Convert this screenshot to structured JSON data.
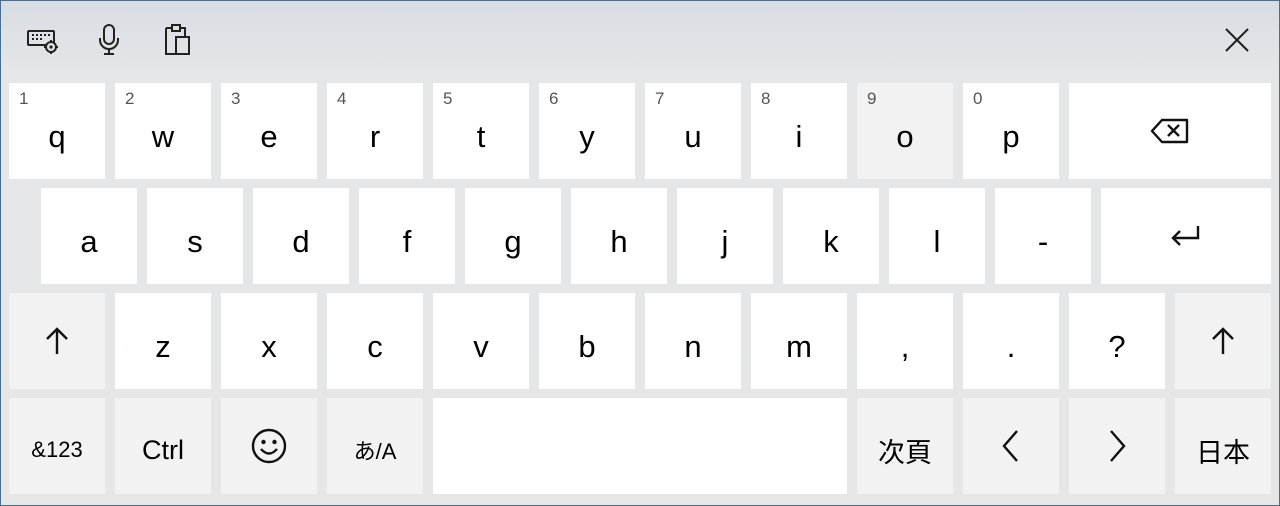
{
  "toolbar": {
    "keyboard_settings_icon": "keyboard-settings-icon",
    "microphone_icon": "microphone-icon",
    "clipboard_icon": "clipboard-icon",
    "close_icon": "close-icon"
  },
  "rows": {
    "row1": [
      {
        "label": "q",
        "num": "1"
      },
      {
        "label": "w",
        "num": "2"
      },
      {
        "label": "e",
        "num": "3"
      },
      {
        "label": "r",
        "num": "4"
      },
      {
        "label": "t",
        "num": "5"
      },
      {
        "label": "y",
        "num": "6"
      },
      {
        "label": "u",
        "num": "7"
      },
      {
        "label": "i",
        "num": "8"
      },
      {
        "label": "o",
        "num": "9"
      },
      {
        "label": "p",
        "num": "0"
      }
    ],
    "row2": [
      {
        "label": "a"
      },
      {
        "label": "s"
      },
      {
        "label": "d"
      },
      {
        "label": "f"
      },
      {
        "label": "g"
      },
      {
        "label": "h"
      },
      {
        "label": "j"
      },
      {
        "label": "k"
      },
      {
        "label": "l"
      },
      {
        "label": "-"
      }
    ],
    "row3": [
      {
        "label": "z"
      },
      {
        "label": "x"
      },
      {
        "label": "c"
      },
      {
        "label": "v"
      },
      {
        "label": "b"
      },
      {
        "label": "n"
      },
      {
        "label": "m"
      },
      {
        "label": ","
      },
      {
        "label": "."
      },
      {
        "label": "?"
      }
    ],
    "row4": {
      "symbols": "&123",
      "ctrl": "Ctrl",
      "ime_mode": "あ/A",
      "next_page": "次頁",
      "language": "日本"
    }
  },
  "icons": {
    "backspace": "backspace-icon",
    "enter": "enter-icon",
    "shift": "shift-up-arrow-icon",
    "emoji": "smiley-emoji-icon",
    "left": "chevron-left-icon",
    "right": "chevron-right-icon"
  },
  "colors": {
    "key": "#ffffff",
    "key_dark": "#f2f2f2",
    "background": "#e6e6e6",
    "frame": "#4a6e8c"
  }
}
